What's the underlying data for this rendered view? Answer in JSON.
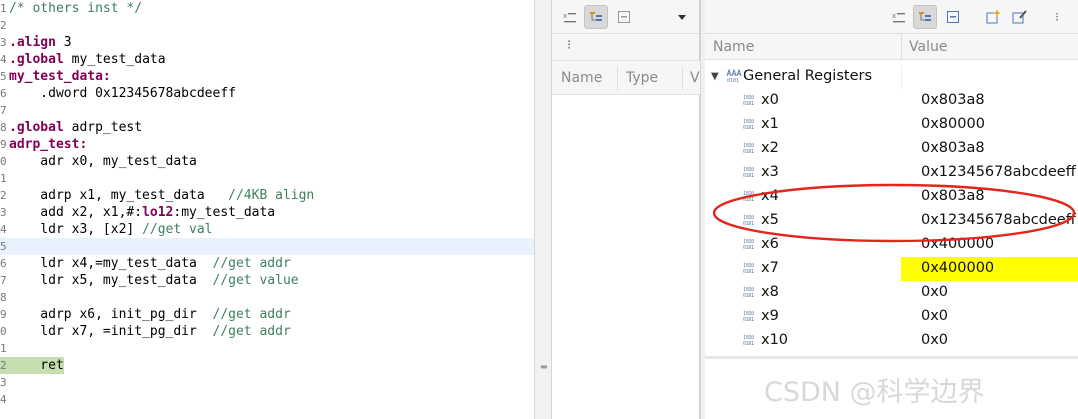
{
  "editor": {
    "lines": [
      {
        "num": "1",
        "parts": [
          {
            "t": "/* others inst */",
            "c": "cmt"
          }
        ]
      },
      {
        "num": "2",
        "parts": []
      },
      {
        "num": "3",
        "parts": [
          {
            "t": ".align",
            "c": "kw"
          },
          {
            "t": " 3",
            "c": ""
          }
        ]
      },
      {
        "num": "4",
        "parts": [
          {
            "t": ".global",
            "c": "kw"
          },
          {
            "t": " my_test_data",
            "c": ""
          }
        ]
      },
      {
        "num": "5",
        "parts": [
          {
            "t": "my_test_data:",
            "c": "lbl"
          }
        ]
      },
      {
        "num": "6",
        "parts": [
          {
            "t": "    .dword 0x12345678abcdeeff",
            "c": ""
          }
        ]
      },
      {
        "num": "7",
        "parts": []
      },
      {
        "num": "8",
        "parts": [
          {
            "t": ".global",
            "c": "kw"
          },
          {
            "t": " adrp_test",
            "c": ""
          }
        ]
      },
      {
        "num": "9",
        "parts": [
          {
            "t": "adrp_test:",
            "c": "lbl"
          }
        ]
      },
      {
        "num": "0",
        "parts": [
          {
            "t": "    adr x0, my_test_data",
            "c": ""
          }
        ]
      },
      {
        "num": "1",
        "parts": []
      },
      {
        "num": "2",
        "parts": [
          {
            "t": "    adrp x1, my_test_data   ",
            "c": ""
          },
          {
            "t": "//4KB align",
            "c": "cmt"
          }
        ]
      },
      {
        "num": "3",
        "parts": [
          {
            "t": "    add x2, x1,#:",
            "c": ""
          },
          {
            "t": "lo12",
            "c": "kw"
          },
          {
            "t": ":my_test_data",
            "c": ""
          }
        ]
      },
      {
        "num": "4",
        "parts": [
          {
            "t": "    ldr x3, [x2] ",
            "c": ""
          },
          {
            "t": "//get val",
            "c": "cmt"
          }
        ]
      },
      {
        "num": "5",
        "parts": [],
        "current": true
      },
      {
        "num": "6",
        "parts": [
          {
            "t": "    ldr x4,=my_test_data  ",
            "c": ""
          },
          {
            "t": "//get addr",
            "c": "cmt"
          }
        ]
      },
      {
        "num": "7",
        "parts": [
          {
            "t": "    ldr x5, my_test_data  ",
            "c": ""
          },
          {
            "t": "//get value",
            "c": "cmt"
          }
        ]
      },
      {
        "num": "8",
        "parts": []
      },
      {
        "num": "9",
        "parts": [
          {
            "t": "    adrp x6, init_pg_dir  ",
            "c": ""
          },
          {
            "t": "//get addr",
            "c": "cmt"
          }
        ]
      },
      {
        "num": "0",
        "parts": [
          {
            "t": "    ldr x7, =init_pg_dir  ",
            "c": ""
          },
          {
            "t": "//get addr",
            "c": "cmt"
          }
        ]
      },
      {
        "num": "1",
        "parts": []
      },
      {
        "num": "2",
        "parts": [
          {
            "t": "    ret",
            "c": ""
          }
        ],
        "ret": true
      },
      {
        "num": "3",
        "parts": []
      },
      {
        "num": "4",
        "parts": []
      }
    ]
  },
  "variables": {
    "columns": [
      "Name",
      "Type",
      "V"
    ]
  },
  "registers": {
    "columns": [
      "Name",
      "Value"
    ],
    "group": "General Registers",
    "rows": [
      {
        "name": "x0",
        "value": "0x803a8"
      },
      {
        "name": "x1",
        "value": "0x80000"
      },
      {
        "name": "x2",
        "value": "0x803a8"
      },
      {
        "name": "x3",
        "value": "0x12345678abcdeeff"
      },
      {
        "name": "x4",
        "value": "0x803a8"
      },
      {
        "name": "x5",
        "value": "0x12345678abcdeeff"
      },
      {
        "name": "x6",
        "value": "0x400000"
      },
      {
        "name": "x7",
        "value": "0x400000",
        "highlight": true
      },
      {
        "name": "x8",
        "value": "0x0"
      },
      {
        "name": "x9",
        "value": "0x0"
      },
      {
        "name": "x10",
        "value": "0x0"
      }
    ],
    "register_icon_text": "1010\n0101"
  },
  "watermark": "CSDN @科学边界",
  "colors": {
    "keyword": "#7f0055",
    "comment": "#3f7f5f",
    "current_line": "#e8f2fe",
    "ret_highlight": "#c5dfb0",
    "value_highlight": "#ffff00",
    "annotation": "#e3261c"
  }
}
